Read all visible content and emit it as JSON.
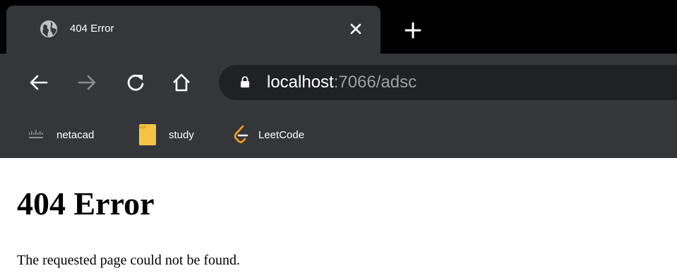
{
  "browser": {
    "tab": {
      "title": "404 Error",
      "favicon": "globe-icon"
    },
    "icons": {
      "close": "close-icon",
      "new_tab": "plus-icon",
      "back": "arrow-left-icon",
      "forward": "arrow-right-icon",
      "reload": "reload-icon",
      "home": "home-icon",
      "lock": "lock-icon"
    },
    "address": {
      "host": "localhost",
      "rest": ":7066/adsc"
    },
    "bookmarks": [
      {
        "label": "netacad",
        "icon": "cisco-logo-icon"
      },
      {
        "label": "study",
        "icon": "folder-icon"
      },
      {
        "label": "LeetCode",
        "icon": "leetcode-logo-icon"
      }
    ],
    "colors": {
      "tabstrip": "#000000",
      "toolbar": "#35363a",
      "omnibox": "#202124",
      "url_muted": "#9aa0a6",
      "folder": "#f6c445",
      "leetcode_orange": "#ffa116"
    }
  },
  "page": {
    "title": "404 Error",
    "message": "The requested page could not be found."
  }
}
